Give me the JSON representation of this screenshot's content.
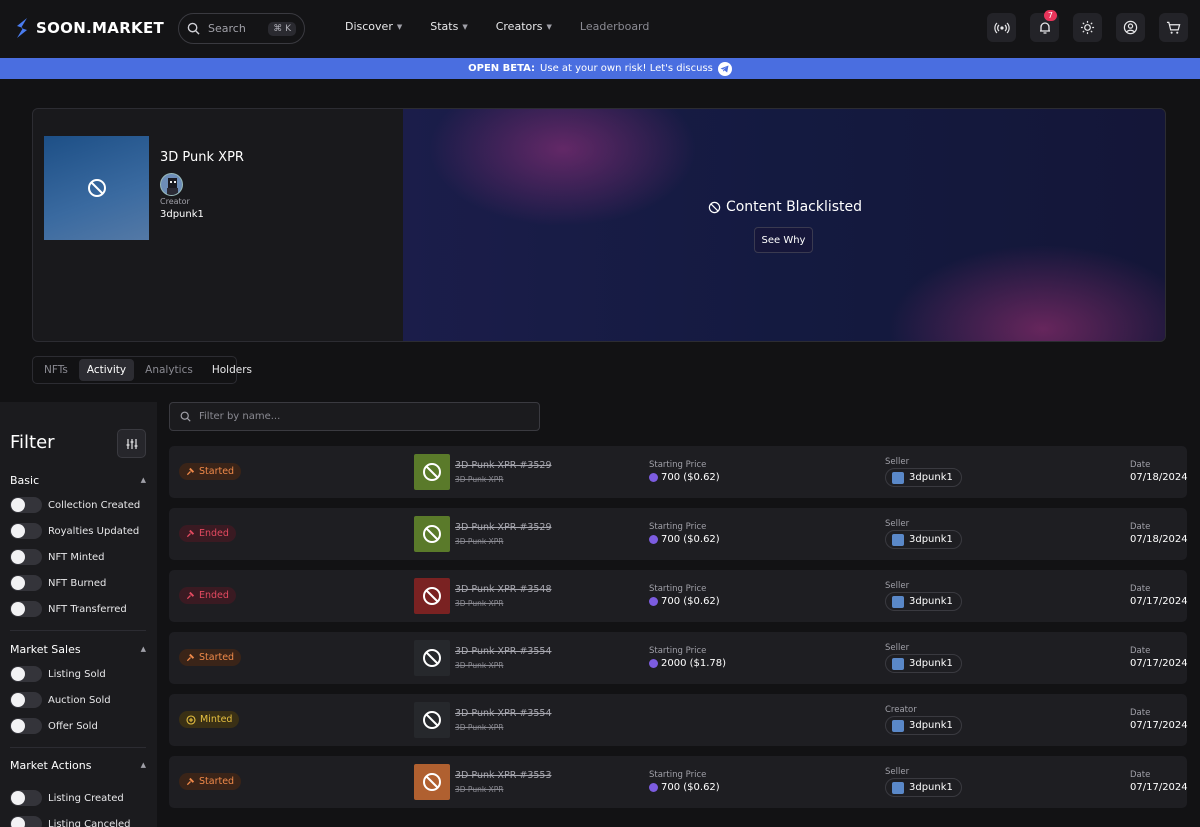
{
  "header": {
    "logo_text": "SOON.MARKET",
    "search_placeholder": "Search",
    "search_shortcut": "⌘ K",
    "nav": [
      {
        "label": "Discover",
        "has_menu": true
      },
      {
        "label": "Stats",
        "has_menu": true
      },
      {
        "label": "Creators",
        "has_menu": true
      },
      {
        "label": "Leaderboard",
        "has_menu": false
      }
    ],
    "notification_count": "7"
  },
  "banner": {
    "bold": "OPEN BETA:",
    "text": "Use at your own risk! Let's discuss"
  },
  "collection": {
    "title": "3D Punk XPR",
    "creator_label": "Creator",
    "creator_name": "3dpunk1",
    "blacklist_text": "Content Blacklisted",
    "see_why": "See Why"
  },
  "tabs": [
    {
      "label": "NFTs",
      "state": "dim"
    },
    {
      "label": "Activity",
      "state": "active"
    },
    {
      "label": "Analytics",
      "state": "dim"
    },
    {
      "label": "Holders",
      "state": "light"
    }
  ],
  "filter": {
    "title": "Filter",
    "sections": [
      {
        "title": "Basic",
        "items": [
          "Collection Created",
          "Royalties Updated",
          "NFT Minted",
          "NFT Burned",
          "NFT Transferred"
        ]
      },
      {
        "title": "Market Sales",
        "items": [
          "Listing Sold",
          "Auction Sold",
          "Offer Sold"
        ]
      },
      {
        "title": "Market Actions",
        "items": [
          "Listing Created",
          "Listing Canceled"
        ]
      }
    ]
  },
  "activity": {
    "search_placeholder": "Filter by name...",
    "rows": [
      {
        "status": "Started",
        "status_type": "started",
        "nft_name": "3D Punk XPR #3529",
        "collection": "3D Punk XPR",
        "img_color": "#5a7a2a",
        "price_label": "Starting Price",
        "price": "700 ($0.62)",
        "party_label": "Seller",
        "party": "3dpunk1",
        "date_label": "Date",
        "date": "07/18/2024"
      },
      {
        "status": "Ended",
        "status_type": "ended",
        "nft_name": "3D Punk XPR #3529",
        "collection": "3D Punk XPR",
        "img_color": "#5a7a2a",
        "price_label": "Starting Price",
        "price": "700 ($0.62)",
        "party_label": "Seller",
        "party": "3dpunk1",
        "date_label": "Date",
        "date": "07/18/2024"
      },
      {
        "status": "Ended",
        "status_type": "ended",
        "nft_name": "3D Punk XPR #3548",
        "collection": "3D Punk XPR",
        "img_color": "#7a2222",
        "price_label": "Starting Price",
        "price": "700 ($0.62)",
        "party_label": "Seller",
        "party": "3dpunk1",
        "date_label": "Date",
        "date": "07/17/2024"
      },
      {
        "status": "Started",
        "status_type": "started",
        "nft_name": "3D Punk XPR #3554",
        "collection": "3D Punk XPR",
        "img_color": "#26282c",
        "price_label": "Starting Price",
        "price": "2000 ($1.78)",
        "party_label": "Seller",
        "party": "3dpunk1",
        "date_label": "Date",
        "date": "07/17/2024"
      },
      {
        "status": "Minted",
        "status_type": "minted",
        "nft_name": "3D Punk XPR #3554",
        "collection": "3D Punk XPR",
        "img_color": "#26282c",
        "price_label": "",
        "price": "",
        "party_label": "Creator",
        "party": "3dpunk1",
        "date_label": "Date",
        "date": "07/17/2024"
      },
      {
        "status": "Started",
        "status_type": "started",
        "nft_name": "3D Punk XPR #3553",
        "collection": "3D Punk XPR",
        "img_color": "#b06030",
        "price_label": "Starting Price",
        "price": "700 ($0.62)",
        "party_label": "Seller",
        "party": "3dpunk1",
        "date_label": "Date",
        "date": "07/17/2024"
      }
    ]
  }
}
